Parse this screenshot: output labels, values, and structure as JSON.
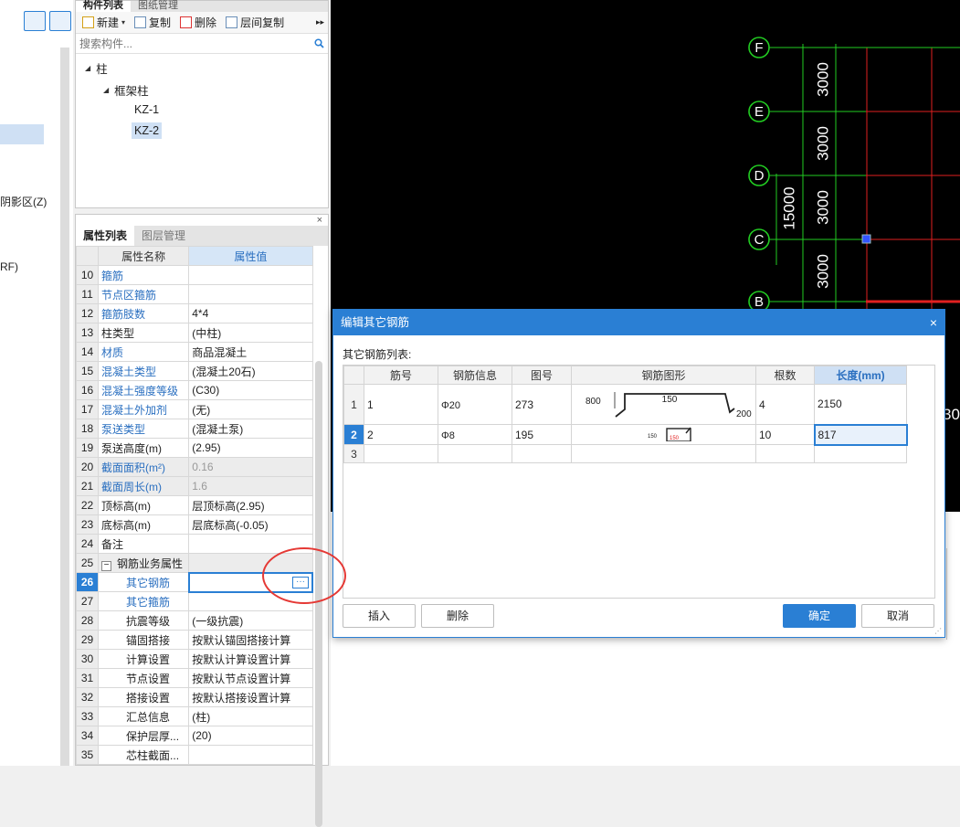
{
  "left_strip": {
    "labels": [
      "阴影区(Z)",
      "RF)"
    ]
  },
  "component_panel": {
    "tabs": [
      "构件列表",
      "图纸管理"
    ],
    "toolbar": {
      "new_label": "新建",
      "copy_label": "复制",
      "delete_label": "删除",
      "floor_copy_label": "层间复制",
      "more": "▸▸"
    },
    "search_placeholder": "搜索构件...",
    "tree": {
      "root": "柱",
      "group": "框架柱",
      "items": [
        "KZ-1",
        "KZ-2"
      ],
      "selected": "KZ-2"
    }
  },
  "property_panel": {
    "tabs": [
      "属性列表",
      "图层管理"
    ],
    "close": "×",
    "header": {
      "name": "属性名称",
      "value": "属性值"
    },
    "rows": [
      {
        "n": "10",
        "name": "箍筋",
        "value": ""
      },
      {
        "n": "11",
        "name": "节点区箍筋",
        "value": ""
      },
      {
        "n": "12",
        "name": "箍筋肢数",
        "value": "4*4"
      },
      {
        "n": "13",
        "name": "柱类型",
        "value": "(中柱)"
      },
      {
        "n": "14",
        "name": "材质",
        "value": "商品混凝土"
      },
      {
        "n": "15",
        "name": "混凝土类型",
        "value": "(混凝土20石)"
      },
      {
        "n": "16",
        "name": "混凝土强度等级",
        "value": "(C30)"
      },
      {
        "n": "17",
        "name": "混凝土外加剂",
        "value": "(无)"
      },
      {
        "n": "18",
        "name": "泵送类型",
        "value": "(混凝土泵)"
      },
      {
        "n": "19",
        "name": "泵送高度(m)",
        "value": "(2.95)"
      },
      {
        "n": "20",
        "name": "截面面积(m²)",
        "value": "0.16"
      },
      {
        "n": "21",
        "name": "截面周长(m)",
        "value": "1.6"
      },
      {
        "n": "22",
        "name": "顶标高(m)",
        "value": "层顶标高(2.95)"
      },
      {
        "n": "23",
        "name": "底标高(m)",
        "value": "层底标高(-0.05)"
      },
      {
        "n": "24",
        "name": "备注",
        "value": ""
      },
      {
        "n": "25",
        "name": "钢筋业务属性",
        "value": ""
      },
      {
        "n": "26",
        "name": "其它钢筋",
        "value": ""
      },
      {
        "n": "27",
        "name": "其它箍筋",
        "value": ""
      },
      {
        "n": "28",
        "name": "抗震等级",
        "value": "(一级抗震)"
      },
      {
        "n": "29",
        "name": "锚固搭接",
        "value": "按默认锚固搭接计算"
      },
      {
        "n": "30",
        "name": "计算设置",
        "value": "按默认计算设置计算"
      },
      {
        "n": "31",
        "name": "节点设置",
        "value": "按默认节点设置计算"
      },
      {
        "n": "32",
        "name": "搭接设置",
        "value": "按默认搭接设置计算"
      },
      {
        "n": "33",
        "name": "汇总信息",
        "value": "(柱)"
      },
      {
        "n": "34",
        "name": "保护层厚...",
        "value": "(20)"
      },
      {
        "n": "35",
        "name": "芯柱截面...",
        "value": ""
      }
    ],
    "expander": "−",
    "ellipsis": "···"
  },
  "canvas": {
    "axes": [
      "F",
      "E",
      "D",
      "C",
      "B"
    ],
    "spans": [
      "3000",
      "3000",
      "3000",
      "3000"
    ],
    "total": "15000",
    "right_fragment": "30"
  },
  "dialog": {
    "title": "编辑其它钢筋",
    "close": "×",
    "subtitle": "其它钢筋列表:",
    "columns": [
      "筋号",
      "钢筋信息",
      "图号",
      "钢筋图形",
      "根数",
      "长度(mm)"
    ],
    "rows": [
      {
        "rn": "1",
        "bar_no": "1",
        "info": "Φ20",
        "fig_no": "273",
        "shape": {
          "a": "800",
          "b": "150",
          "c": "200"
        },
        "count": "4",
        "length": "2150"
      },
      {
        "rn": "2",
        "bar_no": "2",
        "info": "Φ8",
        "fig_no": "195",
        "shape": {
          "a": "150",
          "b": "150"
        },
        "count": "10",
        "length": "817"
      },
      {
        "rn": "3",
        "bar_no": "",
        "info": "",
        "fig_no": "",
        "shape": null,
        "count": "",
        "length": ""
      }
    ],
    "buttons": {
      "insert": "插入",
      "delete": "删除",
      "ok": "确定",
      "cancel": "取消"
    },
    "grip": "⋰"
  },
  "colors": {
    "accent": "#2a7fd4",
    "axis_green": "#22cc22",
    "grid_red": "#e02020",
    "annotation_red": "#e53935"
  }
}
